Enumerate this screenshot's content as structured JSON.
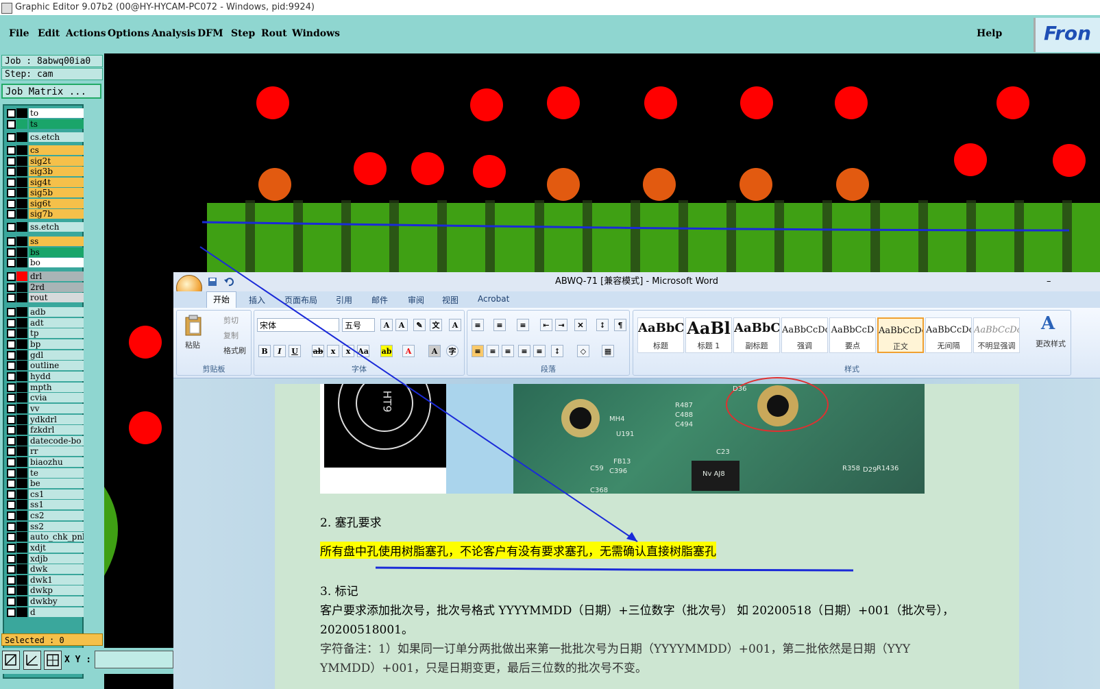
{
  "window": {
    "title": "Graphic Editor 9.07b2 (00@HY-HYCAM-PC072 - Windows, pid:9924)"
  },
  "menu": {
    "items": [
      "File",
      "Edit",
      "Actions",
      "Options",
      "Analysis",
      "DFM",
      "Step",
      "Rout",
      "Windows"
    ],
    "help": "Help",
    "logo": "Fron"
  },
  "job": {
    "job_line": "Job : 8abwq00ia0",
    "step_line": "Step: cam",
    "matrix_button": "Job Matrix ..."
  },
  "layers": [
    {
      "name": "to",
      "bg": "#ffffff",
      "color": "#000000"
    },
    {
      "name": "ts",
      "bg": "#1aa56a",
      "color": "#1aa56a"
    },
    {
      "name": "cs.etch",
      "bg": "#bfe6e2",
      "color": "#000000"
    },
    {
      "name": "cs",
      "bg": "#f5c04a",
      "color": "#000000"
    },
    {
      "name": "sig2t",
      "bg": "#f5c04a",
      "color": "#000000"
    },
    {
      "name": "sig3b",
      "bg": "#f5c04a",
      "color": "#000000"
    },
    {
      "name": "sig4t",
      "bg": "#f5c04a",
      "color": "#000000"
    },
    {
      "name": "sig5b",
      "bg": "#f5c04a",
      "color": "#000000"
    },
    {
      "name": "sig6t",
      "bg": "#f5c04a",
      "color": "#000000"
    },
    {
      "name": "sig7b",
      "bg": "#f5c04a",
      "color": "#000000"
    },
    {
      "name": "ss.etch",
      "bg": "#bfe6e2",
      "color": "#000000"
    },
    {
      "name": "ss",
      "bg": "#f5c04a",
      "color": "#000000"
    },
    {
      "name": "bs",
      "bg": "#1aa56a",
      "color": "#000000"
    },
    {
      "name": "bo",
      "bg": "#ffffff",
      "color": "#000000"
    },
    {
      "name": "drl",
      "bg": "#a9b4b6",
      "color": "#ff0000"
    },
    {
      "name": "2rd",
      "bg": "#a9b4b6",
      "color": "#000000"
    },
    {
      "name": "rout",
      "bg": "#d6dadb",
      "color": "#000000"
    },
    {
      "name": "adb",
      "bg": "#bfe6e2",
      "color": "#000000"
    },
    {
      "name": "adt",
      "bg": "#bfe6e2",
      "color": "#000000"
    },
    {
      "name": "tp",
      "bg": "#bfe6e2",
      "color": "#000000"
    },
    {
      "name": "bp",
      "bg": "#bfe6e2",
      "color": "#000000"
    },
    {
      "name": "gdl",
      "bg": "#bfe6e2",
      "color": "#000000"
    },
    {
      "name": "outline",
      "bg": "#bfe6e2",
      "color": "#000000"
    },
    {
      "name": "hydd",
      "bg": "#bfe6e2",
      "color": "#000000"
    },
    {
      "name": "mpth",
      "bg": "#bfe6e2",
      "color": "#000000"
    },
    {
      "name": "cvia",
      "bg": "#bfe6e2",
      "color": "#000000"
    },
    {
      "name": "vv",
      "bg": "#bfe6e2",
      "color": "#000000"
    },
    {
      "name": "ydkdrl",
      "bg": "#bfe6e2",
      "color": "#000000"
    },
    {
      "name": "fzkdrl",
      "bg": "#bfe6e2",
      "color": "#000000"
    },
    {
      "name": "datecode-bo",
      "bg": "#bfe6e2",
      "color": "#000000"
    },
    {
      "name": "rr",
      "bg": "#bfe6e2",
      "color": "#000000"
    },
    {
      "name": "biaozhu",
      "bg": "#bfe6e2",
      "color": "#000000"
    },
    {
      "name": "te",
      "bg": "#bfe6e2",
      "color": "#000000"
    },
    {
      "name": "be",
      "bg": "#bfe6e2",
      "color": "#000000"
    },
    {
      "name": "cs1",
      "bg": "#bfe6e2",
      "color": "#000000"
    },
    {
      "name": "ss1",
      "bg": "#bfe6e2",
      "color": "#000000"
    },
    {
      "name": "cs2",
      "bg": "#bfe6e2",
      "color": "#000000"
    },
    {
      "name": "ss2",
      "bg": "#bfe6e2",
      "color": "#000000"
    },
    {
      "name": "auto_chk_pnl",
      "bg": "#bfe6e2",
      "color": "#000000"
    },
    {
      "name": "xdjt",
      "bg": "#bfe6e2",
      "color": "#000000"
    },
    {
      "name": "xdjb",
      "bg": "#bfe6e2",
      "color": "#000000"
    },
    {
      "name": "dwk",
      "bg": "#bfe6e2",
      "color": "#000000"
    },
    {
      "name": "dwk1",
      "bg": "#bfe6e2",
      "color": "#000000"
    },
    {
      "name": "dwkp",
      "bg": "#bfe6e2",
      "color": "#000000"
    },
    {
      "name": "dwkby",
      "bg": "#bfe6e2",
      "color": "#000000"
    },
    {
      "name": "d",
      "bg": "#bfe6e2",
      "color": "#000000"
    }
  ],
  "status": {
    "selected": "Selected : 0",
    "xy_label": "X Y :"
  },
  "word": {
    "title": "ABWQ-71 [兼容模式] - Microsoft Word",
    "tabs": [
      "开始",
      "插入",
      "页面布局",
      "引用",
      "邮件",
      "审阅",
      "视图",
      "Acrobat"
    ],
    "clipboard": {
      "paste": "粘贴",
      "cut": "剪切",
      "copy": "复制",
      "format_painter": "格式刷",
      "label": "剪贴板"
    },
    "font": {
      "name": "宋体",
      "size": "五号",
      "label": "字体"
    },
    "paragraph_label": "段落",
    "styles": [
      {
        "sample": "AaBbC",
        "name": "标题"
      },
      {
        "sample": "AaBl",
        "name": "标题 1"
      },
      {
        "sample": "AaBbC",
        "name": "副标题"
      },
      {
        "sample": "AaBbCcDc",
        "name": "强调"
      },
      {
        "sample": "AaBbCcD",
        "name": "要点"
      },
      {
        "sample": "AaBbCcDc",
        "name": "正文"
      },
      {
        "sample": "AaBbCcDc",
        "name": "无间隔"
      },
      {
        "sample": "AaBbCcDc",
        "name": "不明显强调"
      }
    ],
    "styles_label": "样式",
    "change_styles": "更改样式",
    "doc": {
      "h2": "2. 塞孔要求",
      "p2": "所有盘中孔使用树脂塞孔，不论客户有没有要求塞孔，无需确认直接树脂塞孔",
      "h3": "3. 标记",
      "p3a": "客户要求添加批次号，批次号格式 YYYYMMDD（日期）+三位数字（批次号）  如 20200518（日期）+001（批次号），",
      "p3b": "20200518001。",
      "p4a": "字符备注：1）如果同一订单分两批做出来第一批批次号为日期（YYYYMMDD）+001，第二批依然是日期（YYY",
      "p4b": "YMMDD）+001，只是日期变更，最后三位数的批次号不变。"
    },
    "pcb_labels": [
      "D36",
      "R487",
      "C488",
      "C494",
      "C23",
      "FB13",
      "C396",
      "U191",
      "C59",
      "C368",
      "MH4",
      "Nv AJ8",
      "R358",
      "D29",
      "R1436"
    ]
  }
}
